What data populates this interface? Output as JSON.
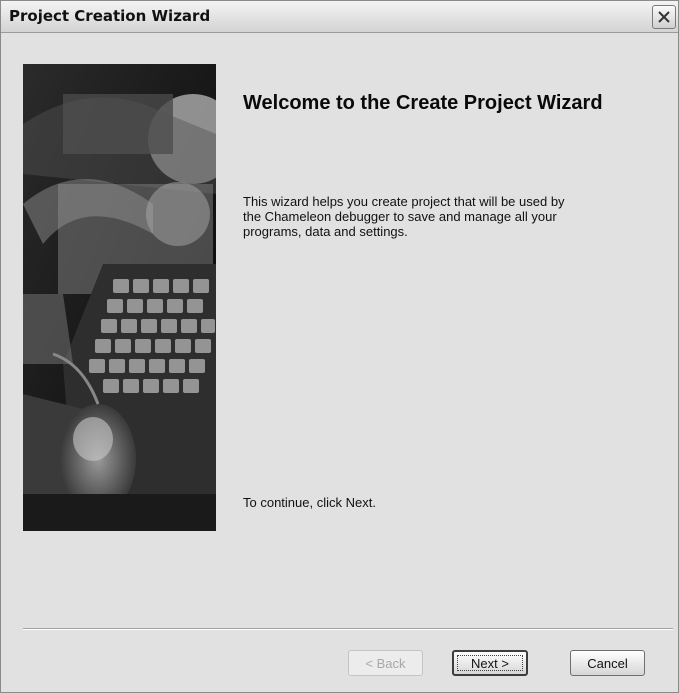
{
  "window": {
    "title": "Project Creation Wizard",
    "close_icon": "close-icon"
  },
  "wizard": {
    "heading": "Welcome to the Create Project Wizard",
    "description": "This wizard helps you create project that will be used by the Chameleon debugger to save and manage all your programs, data and settings.",
    "continue_hint": "To continue, click Next."
  },
  "buttons": {
    "back_label": "< Back",
    "back_enabled": false,
    "next_label": "Next >",
    "cancel_label": "Cancel"
  },
  "colors": {
    "dialog_background": "#e1e1e1",
    "image_background": "#0c0c0c"
  }
}
